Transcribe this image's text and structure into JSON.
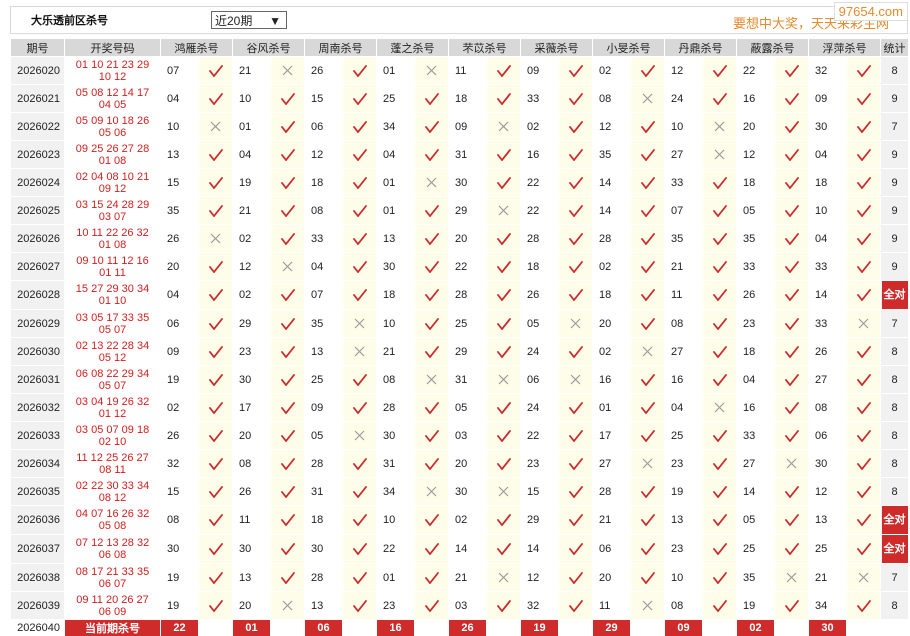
{
  "header": {
    "title": "大乐透前区杀号",
    "select_value": "近20期",
    "select_arrow": "▼",
    "slogan": "要想中大奖，天天来彩主网",
    "watermark": "97654.com"
  },
  "columns": [
    "期号",
    "开奖号码",
    "鸿雁杀号",
    "谷风杀号",
    "周南杀号",
    "蓬之杀号",
    "芣苡杀号",
    "采薇杀号",
    "小旻杀号",
    "丹鼎杀号",
    "蔽露杀号",
    "浮萍杀号",
    "统计"
  ],
  "colors": {
    "check": "#cc2a2a",
    "cross": "#9a9a9a",
    "badge": "#cf2b2b"
  },
  "rows": [
    {
      "period": "2026020",
      "draw": [
        "01 10 21 23 29",
        "10 12"
      ],
      "picks": [
        [
          "07",
          1
        ],
        [
          "21",
          0
        ],
        [
          "26",
          1
        ],
        [
          "01",
          0
        ],
        [
          "11",
          1
        ],
        [
          "09",
          1
        ],
        [
          "02",
          1
        ],
        [
          "12",
          1
        ],
        [
          "22",
          1
        ],
        [
          "32",
          1
        ]
      ],
      "stat": "8"
    },
    {
      "period": "2026021",
      "draw": [
        "05 08 12 14 17",
        "04 05"
      ],
      "picks": [
        [
          "04",
          1
        ],
        [
          "10",
          1
        ],
        [
          "15",
          1
        ],
        [
          "25",
          1
        ],
        [
          "18",
          1
        ],
        [
          "33",
          1
        ],
        [
          "08",
          0
        ],
        [
          "24",
          1
        ],
        [
          "16",
          1
        ],
        [
          "09",
          1
        ]
      ],
      "stat": "9"
    },
    {
      "period": "2026022",
      "draw": [
        "05 09 10 18 26",
        "05 06"
      ],
      "picks": [
        [
          "10",
          0
        ],
        [
          "01",
          1
        ],
        [
          "06",
          1
        ],
        [
          "34",
          1
        ],
        [
          "09",
          0
        ],
        [
          "02",
          1
        ],
        [
          "12",
          1
        ],
        [
          "10",
          0
        ],
        [
          "20",
          1
        ],
        [
          "30",
          1
        ]
      ],
      "stat": "7"
    },
    {
      "period": "2026023",
      "draw": [
        "09 25 26 27 28",
        "01 08"
      ],
      "picks": [
        [
          "13",
          1
        ],
        [
          "04",
          1
        ],
        [
          "12",
          1
        ],
        [
          "04",
          1
        ],
        [
          "31",
          1
        ],
        [
          "16",
          1
        ],
        [
          "35",
          1
        ],
        [
          "27",
          0
        ],
        [
          "12",
          1
        ],
        [
          "04",
          1
        ]
      ],
      "stat": "9"
    },
    {
      "period": "2026024",
      "draw": [
        "02 04 08 10 21",
        "09 12"
      ],
      "picks": [
        [
          "15",
          1
        ],
        [
          "19",
          1
        ],
        [
          "18",
          1
        ],
        [
          "01",
          0
        ],
        [
          "30",
          1
        ],
        [
          "22",
          1
        ],
        [
          "14",
          1
        ],
        [
          "33",
          1
        ],
        [
          "18",
          1
        ],
        [
          "18",
          1
        ]
      ],
      "stat": "9"
    },
    {
      "period": "2026025",
      "draw": [
        "03 15 24 28 29",
        "03 07"
      ],
      "picks": [
        [
          "35",
          1
        ],
        [
          "21",
          1
        ],
        [
          "08",
          1
        ],
        [
          "01",
          1
        ],
        [
          "29",
          0
        ],
        [
          "22",
          1
        ],
        [
          "14",
          1
        ],
        [
          "07",
          1
        ],
        [
          "05",
          1
        ],
        [
          "10",
          1
        ]
      ],
      "stat": "9"
    },
    {
      "period": "2026026",
      "draw": [
        "10 11 22 26 32",
        "01 08"
      ],
      "picks": [
        [
          "26",
          0
        ],
        [
          "02",
          1
        ],
        [
          "33",
          1
        ],
        [
          "13",
          1
        ],
        [
          "20",
          1
        ],
        [
          "28",
          1
        ],
        [
          "28",
          1
        ],
        [
          "35",
          1
        ],
        [
          "35",
          1
        ],
        [
          "04",
          1
        ]
      ],
      "stat": "9"
    },
    {
      "period": "2026027",
      "draw": [
        "09 10 11 12 16",
        "01 11"
      ],
      "picks": [
        [
          "20",
          1
        ],
        [
          "12",
          0
        ],
        [
          "04",
          1
        ],
        [
          "30",
          1
        ],
        [
          "22",
          1
        ],
        [
          "18",
          1
        ],
        [
          "02",
          1
        ],
        [
          "21",
          1
        ],
        [
          "33",
          1
        ],
        [
          "33",
          1
        ]
      ],
      "stat": "9"
    },
    {
      "period": "2026028",
      "draw": [
        "15 27 29 30 34",
        "01 10"
      ],
      "picks": [
        [
          "04",
          1
        ],
        [
          "02",
          1
        ],
        [
          "07",
          1
        ],
        [
          "18",
          1
        ],
        [
          "28",
          1
        ],
        [
          "26",
          1
        ],
        [
          "18",
          1
        ],
        [
          "11",
          1
        ],
        [
          "26",
          1
        ],
        [
          "14",
          1
        ]
      ],
      "stat": "全对"
    },
    {
      "period": "2026029",
      "draw": [
        "03 05 17 33 35",
        "05 07"
      ],
      "picks": [
        [
          "06",
          1
        ],
        [
          "29",
          1
        ],
        [
          "35",
          0
        ],
        [
          "10",
          1
        ],
        [
          "25",
          1
        ],
        [
          "05",
          0
        ],
        [
          "20",
          1
        ],
        [
          "08",
          1
        ],
        [
          "23",
          1
        ],
        [
          "33",
          0
        ]
      ],
      "stat": "7"
    },
    {
      "period": "2026030",
      "draw": [
        "02 13 22 28 34",
        "05 12"
      ],
      "picks": [
        [
          "09",
          1
        ],
        [
          "23",
          1
        ],
        [
          "13",
          0
        ],
        [
          "21",
          1
        ],
        [
          "29",
          1
        ],
        [
          "24",
          1
        ],
        [
          "02",
          0
        ],
        [
          "27",
          1
        ],
        [
          "18",
          1
        ],
        [
          "26",
          1
        ]
      ],
      "stat": "8"
    },
    {
      "period": "2026031",
      "draw": [
        "06 08 22 29 34",
        "05 07"
      ],
      "picks": [
        [
          "19",
          1
        ],
        [
          "30",
          1
        ],
        [
          "25",
          1
        ],
        [
          "08",
          0
        ],
        [
          "31",
          0
        ],
        [
          "06",
          0
        ],
        [
          "16",
          1
        ],
        [
          "16",
          1
        ],
        [
          "04",
          1
        ],
        [
          "27",
          1
        ]
      ],
      "stat": "8"
    },
    {
      "period": "2026032",
      "draw": [
        "03 04 19 26 32",
        "01 12"
      ],
      "picks": [
        [
          "02",
          1
        ],
        [
          "17",
          1
        ],
        [
          "09",
          1
        ],
        [
          "28",
          1
        ],
        [
          "05",
          1
        ],
        [
          "24",
          1
        ],
        [
          "01",
          1
        ],
        [
          "04",
          0
        ],
        [
          "16",
          1
        ],
        [
          "08",
          1
        ]
      ],
      "stat": "8"
    },
    {
      "period": "2026033",
      "draw": [
        "03 05 07 09 18",
        "02 10"
      ],
      "picks": [
        [
          "26",
          1
        ],
        [
          "20",
          1
        ],
        [
          "05",
          0
        ],
        [
          "30",
          1
        ],
        [
          "03",
          1
        ],
        [
          "22",
          1
        ],
        [
          "17",
          1
        ],
        [
          "25",
          1
        ],
        [
          "33",
          1
        ],
        [
          "06",
          1
        ]
      ],
      "stat": "8"
    },
    {
      "period": "2026034",
      "draw": [
        "11 12 25 26 27",
        "08 11"
      ],
      "picks": [
        [
          "32",
          1
        ],
        [
          "08",
          1
        ],
        [
          "28",
          1
        ],
        [
          "31",
          1
        ],
        [
          "20",
          1
        ],
        [
          "23",
          1
        ],
        [
          "27",
          0
        ],
        [
          "23",
          1
        ],
        [
          "27",
          0
        ],
        [
          "30",
          1
        ]
      ],
      "stat": "8"
    },
    {
      "period": "2026035",
      "draw": [
        "02 22 30 33 34",
        "08 12"
      ],
      "picks": [
        [
          "15",
          1
        ],
        [
          "26",
          1
        ],
        [
          "31",
          1
        ],
        [
          "34",
          0
        ],
        [
          "30",
          0
        ],
        [
          "15",
          1
        ],
        [
          "28",
          1
        ],
        [
          "19",
          1
        ],
        [
          "14",
          1
        ],
        [
          "12",
          1
        ]
      ],
      "stat": "8"
    },
    {
      "period": "2026036",
      "draw": [
        "04 07 16 26 32",
        "05 08"
      ],
      "picks": [
        [
          "08",
          1
        ],
        [
          "11",
          1
        ],
        [
          "18",
          1
        ],
        [
          "10",
          1
        ],
        [
          "02",
          1
        ],
        [
          "29",
          1
        ],
        [
          "21",
          1
        ],
        [
          "13",
          1
        ],
        [
          "05",
          1
        ],
        [
          "13",
          1
        ]
      ],
      "stat": "全对"
    },
    {
      "period": "2026037",
      "draw": [
        "07 12 13 28 32",
        "06 08"
      ],
      "picks": [
        [
          "30",
          1
        ],
        [
          "30",
          1
        ],
        [
          "30",
          1
        ],
        [
          "22",
          1
        ],
        [
          "14",
          1
        ],
        [
          "14",
          1
        ],
        [
          "06",
          1
        ],
        [
          "23",
          1
        ],
        [
          "25",
          1
        ],
        [
          "25",
          1
        ]
      ],
      "stat": "全对"
    },
    {
      "period": "2026038",
      "draw": [
        "08 17 21 33 35",
        "06 07"
      ],
      "picks": [
        [
          "19",
          1
        ],
        [
          "13",
          1
        ],
        [
          "28",
          1
        ],
        [
          "01",
          1
        ],
        [
          "21",
          0
        ],
        [
          "12",
          1
        ],
        [
          "20",
          1
        ],
        [
          "10",
          1
        ],
        [
          "35",
          0
        ],
        [
          "21",
          0
        ]
      ],
      "stat": "7"
    },
    {
      "period": "2026039",
      "draw": [
        "09 11 20 26 27",
        "06 09"
      ],
      "picks": [
        [
          "19",
          1
        ],
        [
          "20",
          0
        ],
        [
          "13",
          1
        ],
        [
          "23",
          1
        ],
        [
          "03",
          1
        ],
        [
          "32",
          1
        ],
        [
          "11",
          0
        ],
        [
          "08",
          1
        ],
        [
          "19",
          1
        ],
        [
          "34",
          1
        ]
      ],
      "stat": "8"
    }
  ],
  "current": {
    "period": "2026040",
    "label": "当前期杀号",
    "picks": [
      "22",
      "01",
      "06",
      "16",
      "26",
      "19",
      "29",
      "09",
      "02",
      "30"
    ]
  }
}
